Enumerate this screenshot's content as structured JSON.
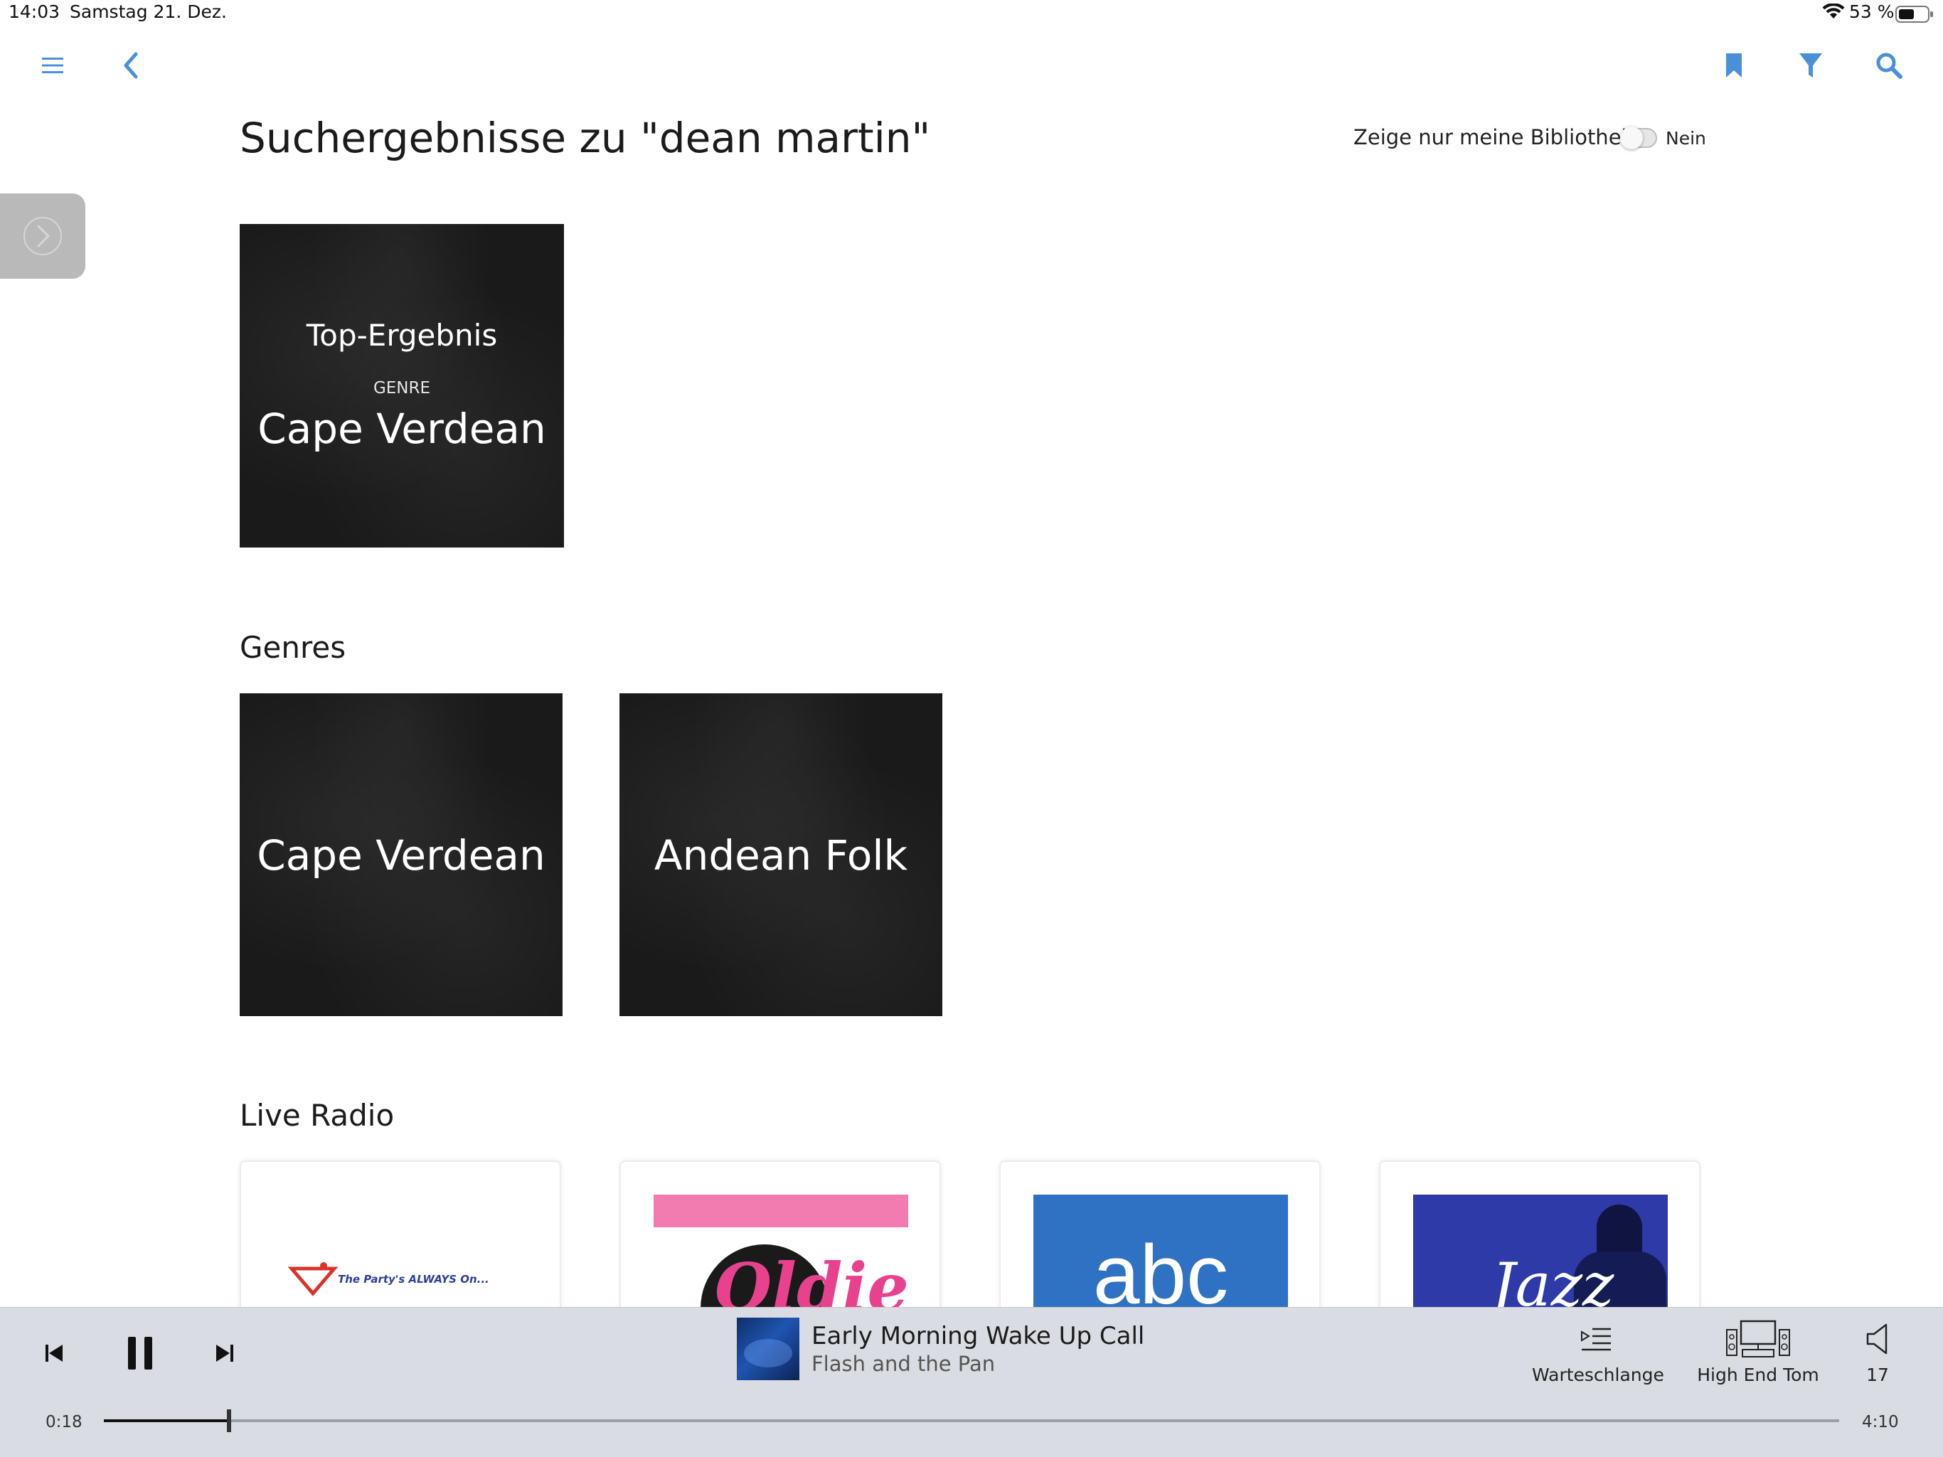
{
  "status_bar": {
    "time": "14:03",
    "date": "Samstag 21. Dez.",
    "battery": "53 %"
  },
  "nav": {
    "icons": [
      "menu-icon",
      "back-icon",
      "bookmark-icon",
      "filter-icon",
      "search-icon"
    ],
    "accent_color": "#4a90d9"
  },
  "page": {
    "title": "Suchergebnisse zu \"dean martin\"",
    "library_toggle": {
      "label": "Zeige nur meine Bibliothek",
      "value": "Nein",
      "on": false
    }
  },
  "top_result": {
    "heading": "Top-Ergebnis",
    "type": "GENRE",
    "name": "Cape Verdean"
  },
  "genres": {
    "heading": "Genres",
    "items": [
      {
        "name": "Cape Verdean"
      },
      {
        "name": "Andean Folk"
      }
    ]
  },
  "live_radio": {
    "heading": "Live Radio",
    "stations": [
      {
        "logo_text": "The Party's ALWAYS On..."
      },
      {
        "logo_text": "Oldies"
      },
      {
        "logo_text": "abc"
      },
      {
        "logo_text": "Jazz"
      }
    ]
  },
  "player": {
    "track_title": "Early Morning Wake Up Call",
    "track_artist": "Flash and the Pan",
    "queue_label": "Warteschlange",
    "room_label": "High End Tom",
    "volume": "17",
    "elapsed": "0:18",
    "duration": "4:10",
    "progress_fraction": 0.072
  }
}
